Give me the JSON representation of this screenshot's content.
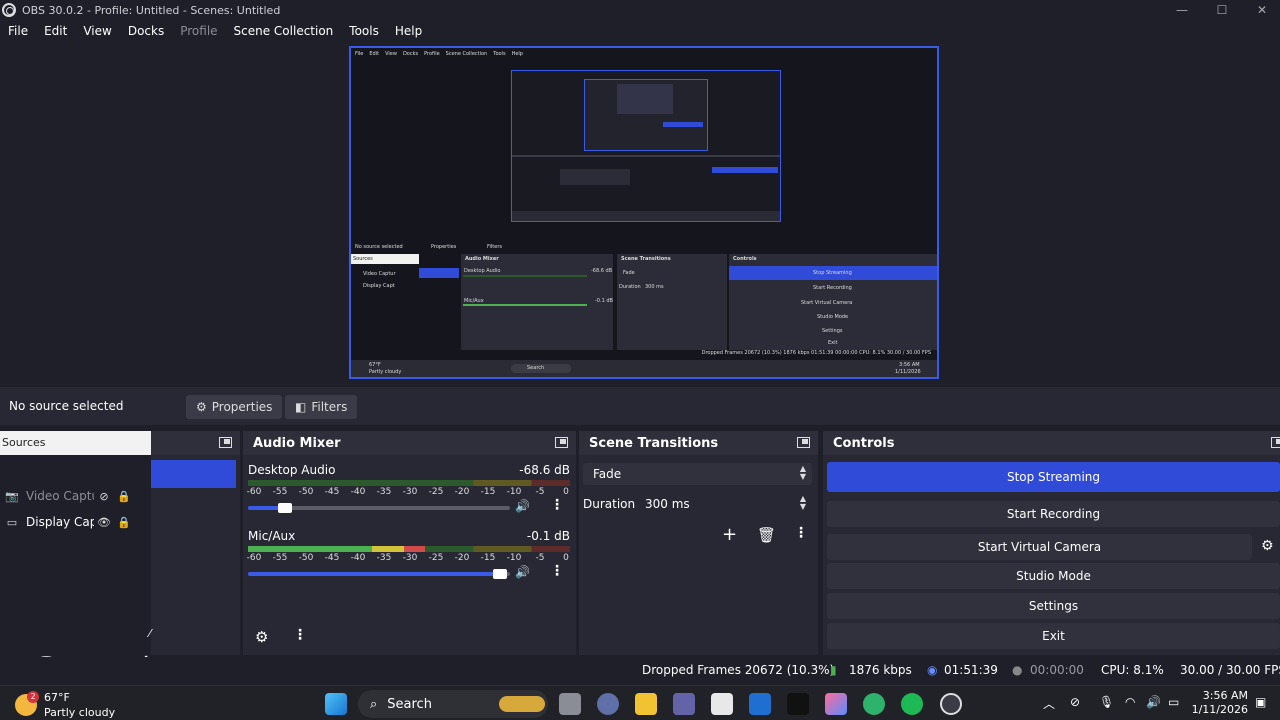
{
  "window": {
    "title": "OBS 30.0.2 - Profile: Untitled - Scenes: Untitled",
    "minimize": "—",
    "maximize": "☐",
    "close": "✕"
  },
  "menu": [
    "File",
    "Edit",
    "View",
    "Docks",
    "Profile",
    "Scene Collection",
    "Tools",
    "Help"
  ],
  "preview_mini": {
    "menu": [
      "File",
      "Edit",
      "View",
      "Docks",
      "Profile",
      "Scene Collection",
      "Tools",
      "Help"
    ],
    "no_source": "No source selected",
    "properties": "Properties",
    "filters": "Filters",
    "sources": "Sources",
    "src1": "Video Captur",
    "src2": "Display Capt",
    "audio_mixer": "Audio Mixer",
    "desktop_audio": "Desktop Audio",
    "desktop_db": "-68.6 dB",
    "mic": "Mic/Aux",
    "mic_db": "-0.1 dB",
    "scene_transitions": "Scene Transitions",
    "fade": "Fade",
    "duration": "Duration",
    "duration_val": "300 ms",
    "controls": "Controls",
    "buttons": [
      "Stop Streaming",
      "Start Recording",
      "Start Virtual Camera",
      "Studio Mode",
      "Settings",
      "Exit"
    ],
    "status": "Dropped Frames 20672 (10.3%)   1876 kbps   01:51:39   00:00:00   CPU: 8.1%   30.00 / 30.00 FPS",
    "search": "Search",
    "temp": "67°F",
    "weather": "Partly cloudy",
    "time": "3:56 AM",
    "date": "1/11/2026"
  },
  "context": {
    "no_source": "No source selected",
    "properties": "Properties",
    "filters": "Filters"
  },
  "sources": {
    "tab_label": "Sources",
    "items": [
      {
        "name": "Video Captur",
        "icon": "camera-icon"
      },
      {
        "name": "Display Capt",
        "icon": "monitor-icon"
      }
    ]
  },
  "mixer": {
    "title": "Audio Mixer",
    "scale": [
      "-60",
      "-55",
      "-50",
      "-45",
      "-40",
      "-35",
      "-30",
      "-25",
      "-20",
      "-15",
      "-10",
      "-5",
      "0"
    ],
    "channels": [
      {
        "name": "Desktop Audio",
        "db": "-68.6 dB",
        "level": 0.0,
        "volume": 0.14
      },
      {
        "name": "Mic/Aux",
        "db": "-0.1 dB",
        "level": 0.55,
        "volume": 0.96
      }
    ]
  },
  "transitions": {
    "title": "Scene Transitions",
    "selected": "Fade",
    "duration_label": "Duration",
    "duration_value": "300 ms"
  },
  "controls": {
    "title": "Controls",
    "stop_streaming": "Stop Streaming",
    "start_recording": "Start Recording",
    "start_virtual_camera": "Start Virtual Camera",
    "studio_mode": "Studio Mode",
    "settings": "Settings",
    "exit": "Exit"
  },
  "status": {
    "dropped": "Dropped Frames 20672 (10.3%)",
    "kbps": "1876 kbps",
    "stream_time": "01:51:39",
    "rec_time": "00:00:00",
    "cpu": "CPU: 8.1%",
    "fps": "30.00 / 30.00 FPS"
  },
  "taskbar": {
    "temp": "67°F",
    "weather": "Partly cloudy",
    "weather_badge": "2",
    "search": "Search",
    "time": "3:56 AM",
    "date": "1/11/2026"
  },
  "colors": {
    "accent": "#2f4bd8",
    "panel": "#272833",
    "background": "#1e1f29"
  }
}
